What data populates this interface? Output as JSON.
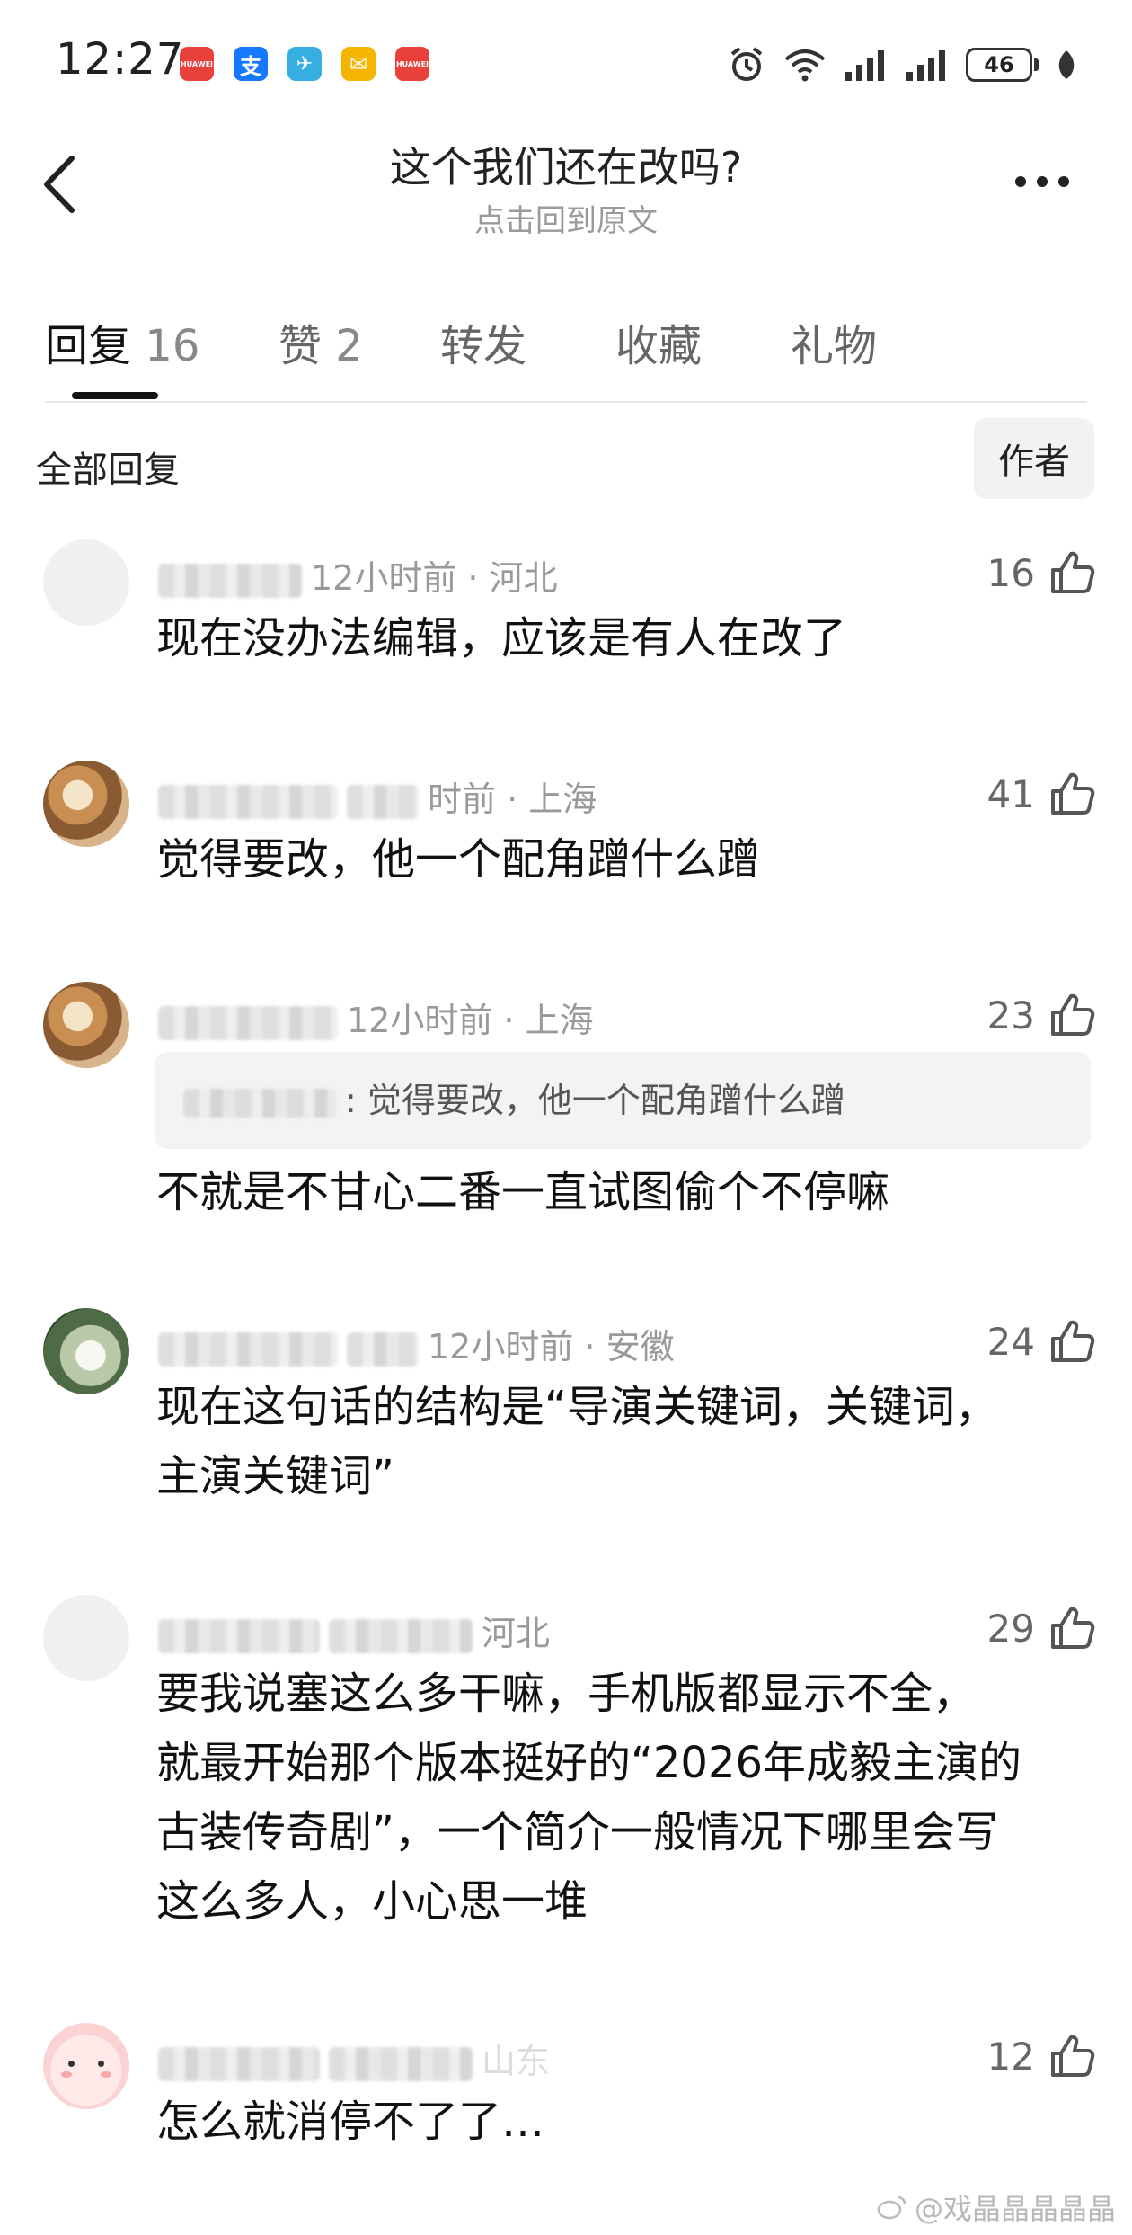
{
  "status_bar": {
    "time": "12:27",
    "app_icons": [
      {
        "name": "huawei-app-icon",
        "label": "HUAWEI",
        "color": "#e8413c"
      },
      {
        "name": "alipay-icon",
        "label": "支",
        "color": "#1677ff"
      },
      {
        "name": "telegram-icon",
        "label": "✈",
        "color": "#37aee2"
      },
      {
        "name": "mail-icon",
        "label": "✉",
        "color": "#f5b400"
      },
      {
        "name": "huawei-app-icon-2",
        "label": "HUAWEI",
        "color": "#e8413c"
      }
    ],
    "battery": "46"
  },
  "header": {
    "title": "这个我们还在改吗?",
    "subtitle": "点击回到原文"
  },
  "tabs": [
    {
      "label": "回复",
      "count": "16"
    },
    {
      "label": "赞",
      "count": "2"
    },
    {
      "label": "转发",
      "count": ""
    },
    {
      "label": "收藏",
      "count": ""
    },
    {
      "label": "礼物",
      "count": ""
    }
  ],
  "section": {
    "label": "全部回复",
    "author_filter": "作者"
  },
  "comments": [
    {
      "time_loc": "12小时前 · 河北",
      "likes": "16",
      "text_lines": [
        "现在没办法编辑，应该是有人在改了"
      ]
    },
    {
      "time_loc": "时前 · 上海",
      "likes": "41",
      "text_lines": [
        "觉得要改，他一个配角蹭什么蹭"
      ]
    },
    {
      "time_loc": "12小时前 · 上海",
      "likes": "23",
      "quote": ": 觉得要改，他一个配角蹭什么蹭",
      "text_lines": [
        "不就是不甘心二番一直试图偷个不停嘛"
      ]
    },
    {
      "time_loc": "12小时前 · 安徽",
      "likes": "24",
      "text_lines": [
        "现在这句话的结构是“导演关键词，关键词，",
        "主演关键词”"
      ]
    },
    {
      "time_loc": "河北",
      "likes": "29",
      "text_lines": [
        "要我说塞这么多干嘛，手机版都显示不全，",
        "就最开始那个版本挺好的“2026年成毅主演的",
        "古装传奇剧”，一个简介一般情况下哪里会写",
        "这么多人，小心思一堆"
      ]
    },
    {
      "time_loc": "山东",
      "likes": "12",
      "text_lines": [
        "怎么就消停不了了…"
      ]
    }
  ],
  "watermark": "@戏晶晶晶晶晶"
}
